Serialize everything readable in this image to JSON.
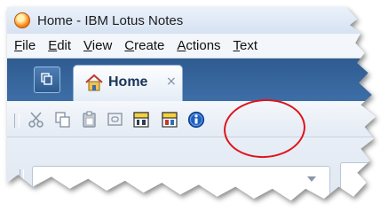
{
  "window": {
    "title": "Home - IBM Lotus Notes",
    "app_icon": "lotus-notes-logo-icon"
  },
  "menubar": {
    "items": [
      {
        "label": "File",
        "mnemonic": "F",
        "rest": "ile"
      },
      {
        "label": "Edit",
        "mnemonic": "E",
        "rest": "dit"
      },
      {
        "label": "View",
        "mnemonic": "V",
        "rest": "iew"
      },
      {
        "label": "Create",
        "mnemonic": "C",
        "rest": "reate"
      },
      {
        "label": "Actions",
        "mnemonic": "A",
        "rest": "ctions"
      },
      {
        "label": "Text",
        "mnemonic": "T",
        "rest": "ext"
      }
    ]
  },
  "tabs": {
    "switcher_icon": "open-list-icon",
    "active": {
      "label": "Home",
      "icon": "home-icon",
      "close_glyph": "×"
    }
  },
  "toolbar": {
    "buttons": [
      {
        "name": "cut-icon"
      },
      {
        "name": "copy-icon"
      },
      {
        "name": "paste-icon"
      },
      {
        "name": "copy-as-link-icon"
      },
      {
        "name": "mail-memo-icon"
      },
      {
        "name": "mail-reply-icon"
      },
      {
        "name": "info-icon"
      }
    ],
    "highlight_color": "#e0141c"
  }
}
